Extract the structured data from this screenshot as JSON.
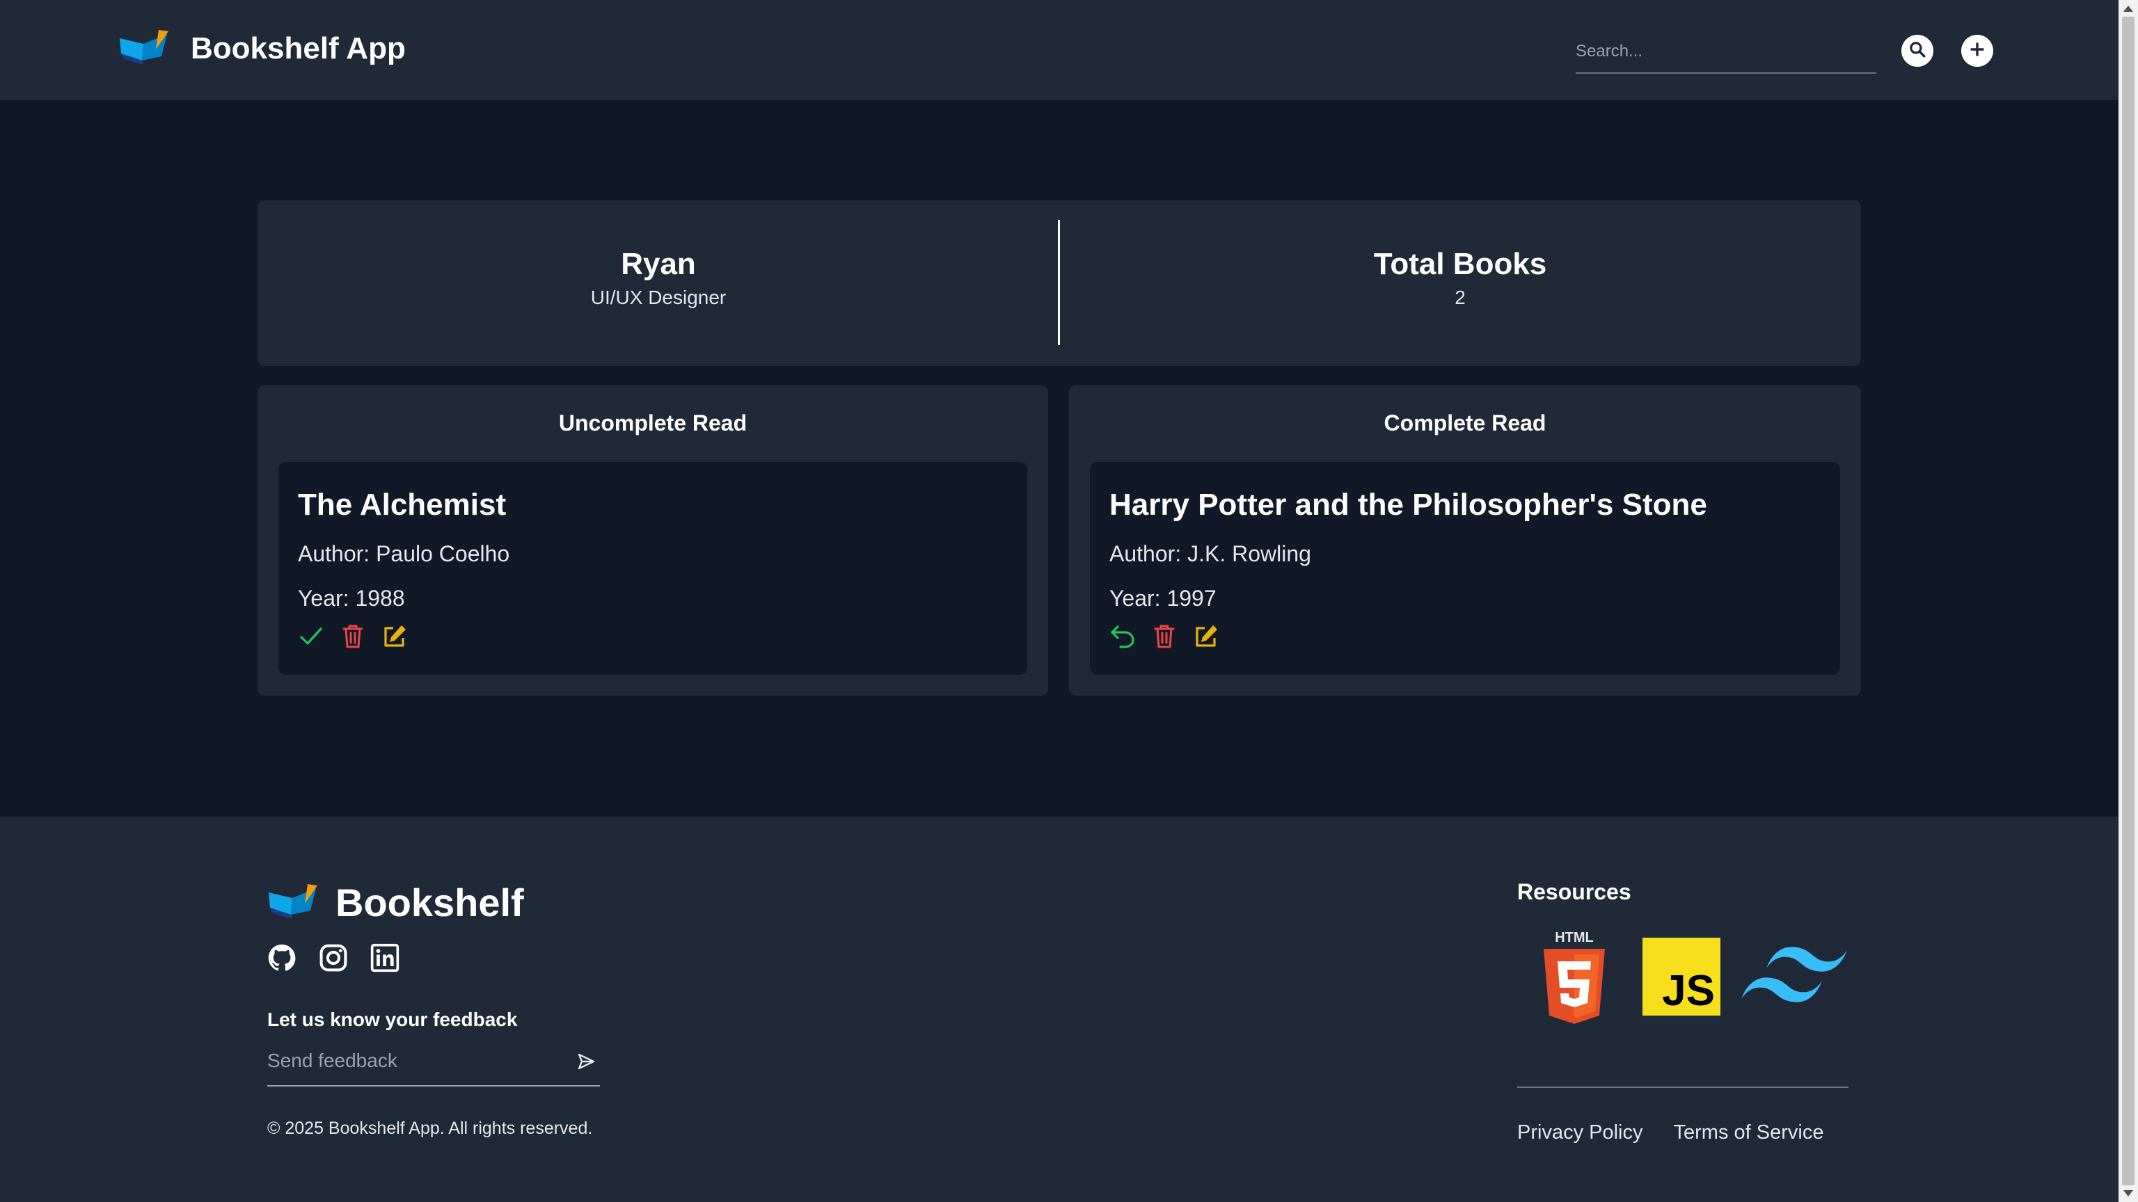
{
  "header": {
    "app_title": "Bookshelf App",
    "search_placeholder": "Search...",
    "search_button_icon": "search-icon",
    "add_button_icon": "plus-icon"
  },
  "profile": {
    "name": "Ryan",
    "role": "UI/UX Designer",
    "total_label": "Total Books",
    "total_value": "2"
  },
  "shelves": {
    "uncomplete": {
      "title": "Uncomplete Read",
      "books": [
        {
          "title": "The Alchemist",
          "author": "Author: Paulo Coelho",
          "year": "Year: 1988",
          "actions": [
            "check-icon",
            "trash-icon",
            "edit-icon"
          ]
        }
      ]
    },
    "complete": {
      "title": "Complete Read",
      "books": [
        {
          "title": "Harry Potter and the Philosopher's Stone",
          "author": "Author: J.K. Rowling",
          "year": "Year: 1997",
          "actions": [
            "undo-icon",
            "trash-icon",
            "edit-icon"
          ]
        }
      ]
    }
  },
  "footer": {
    "brand": "Bookshelf",
    "socials": [
      "github-icon",
      "instagram-icon",
      "linkedin-icon"
    ],
    "feedback_label": "Let us know your feedback",
    "feedback_placeholder": "Send feedback",
    "copyright": "© 2025 Bookshelf App. All rights reserved.",
    "resources_title": "Resources",
    "resources": [
      "html5-logo",
      "javascript-logo",
      "tailwind-logo"
    ],
    "js_logo_text": "JS",
    "html_logo_text": "HTML",
    "links": [
      "Privacy Policy",
      "Terms of Service"
    ]
  },
  "colors": {
    "page_bg": "#111827",
    "panel_bg": "#1f2937",
    "success": "#22c55e",
    "danger": "#ef4444",
    "warning": "#eab308"
  }
}
